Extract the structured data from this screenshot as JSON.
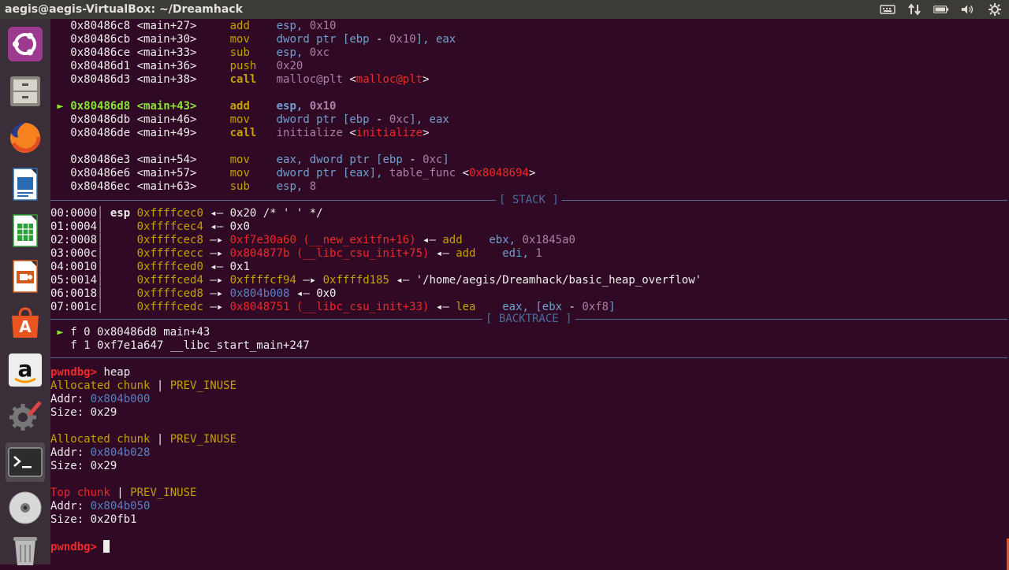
{
  "window": {
    "title": "aegis@aegis-VirtualBox: ~/Dreamhack"
  },
  "tray_icons": [
    "keyboard-icon",
    "network-icon",
    "battery-icon",
    "volume-icon",
    "settings-gear-icon"
  ],
  "launcher": [
    {
      "name": "ubuntu-dash-icon"
    },
    {
      "name": "files-icon"
    },
    {
      "name": "firefox-icon"
    },
    {
      "name": "libreoffice-writer-icon"
    },
    {
      "name": "libreoffice-calc-icon"
    },
    {
      "name": "libreoffice-impress-icon"
    },
    {
      "name": "software-center-icon"
    },
    {
      "name": "amazon-icon"
    },
    {
      "name": "system-settings-icon"
    },
    {
      "name": "terminal-icon"
    },
    {
      "name": "dvd-icon"
    },
    {
      "name": "trash-icon"
    }
  ],
  "colors": {
    "terminal_bg": "#300a24",
    "launcher_bg": "#3a2f38",
    "topbar_bg": "#3c3b37"
  },
  "disasm": [
    {
      "marker": "",
      "addr": "0x80486c8",
      "off": "<main+27>",
      "mn": "add",
      "ops": [
        [
          "esp, ",
          "blue"
        ],
        [
          "0x10",
          "purple"
        ]
      ],
      "cur": false
    },
    {
      "marker": "",
      "addr": "0x80486cb",
      "off": "<main+30>",
      "mn": "mov",
      "ops": [
        [
          "dword ptr [",
          "blue"
        ],
        [
          "ebp",
          "blue"
        ],
        [
          " - ",
          "white"
        ],
        [
          "0x10",
          "purple"
        ],
        [
          "], ",
          "blue"
        ],
        [
          "eax",
          "blue"
        ]
      ],
      "cur": false
    },
    {
      "marker": "",
      "addr": "0x80486ce",
      "off": "<main+33>",
      "mn": "sub",
      "ops": [
        [
          "esp, ",
          "blue"
        ],
        [
          "0xc",
          "purple"
        ]
      ],
      "cur": false
    },
    {
      "marker": "",
      "addr": "0x80486d1",
      "off": "<main+36>",
      "mn": "push",
      "ops": [
        [
          "0x20",
          "purple"
        ]
      ],
      "cur": false
    },
    {
      "marker": "",
      "addr": "0x80486d3",
      "off": "<main+38>",
      "mn": "call",
      "ops": [
        [
          "malloc@plt ",
          "purple"
        ],
        [
          "<",
          "white"
        ],
        [
          "malloc@plt",
          "red"
        ],
        [
          ">",
          "white"
        ]
      ],
      "cur": false,
      "bold": true
    },
    {
      "blank": true
    },
    {
      "marker": "►",
      "addr": "0x80486d8",
      "off": "<main+43>",
      "mn": "add",
      "ops": [
        [
          "esp, ",
          "blue"
        ],
        [
          "0x10",
          "purple"
        ]
      ],
      "cur": true
    },
    {
      "marker": "",
      "addr": "0x80486db",
      "off": "<main+46>",
      "mn": "mov",
      "ops": [
        [
          "dword ptr [",
          "blue"
        ],
        [
          "ebp",
          "blue"
        ],
        [
          " - ",
          "white"
        ],
        [
          "0xc",
          "purple"
        ],
        [
          "], ",
          "blue"
        ],
        [
          "eax",
          "blue"
        ]
      ],
      "cur": false
    },
    {
      "marker": "",
      "addr": "0x80486de",
      "off": "<main+49>",
      "mn": "call",
      "ops": [
        [
          "initialize ",
          "purple"
        ],
        [
          "<",
          "white"
        ],
        [
          "initialize",
          "red"
        ],
        [
          ">",
          "white"
        ]
      ],
      "cur": false,
      "bold": true
    },
    {
      "blank": true
    },
    {
      "marker": "",
      "addr": "0x80486e3",
      "off": "<main+54>",
      "mn": "mov",
      "ops": [
        [
          "eax, dword ptr [",
          "blue"
        ],
        [
          "ebp",
          "blue"
        ],
        [
          " - ",
          "white"
        ],
        [
          "0xc",
          "purple"
        ],
        [
          "]",
          "blue"
        ]
      ],
      "cur": false
    },
    {
      "marker": "",
      "addr": "0x80486e6",
      "off": "<main+57>",
      "mn": "mov",
      "ops": [
        [
          "dword ptr [",
          "blue"
        ],
        [
          "eax",
          "blue"
        ],
        [
          "], ",
          "blue"
        ],
        [
          "table_func ",
          "purple"
        ],
        [
          "<",
          "white"
        ],
        [
          "0x8048694",
          "red"
        ],
        [
          ">",
          "white"
        ]
      ],
      "cur": false
    },
    {
      "marker": "",
      "addr": "0x80486ec",
      "off": "<main+63>",
      "mn": "sub",
      "ops": [
        [
          "esp, ",
          "blue"
        ],
        [
          "8",
          "purple"
        ]
      ],
      "cur": false
    }
  ],
  "stack_label": "[ STACK ]",
  "stack": [
    [
      [
        "00:0000",
        "white"
      ],
      [
        "│ ",
        "dim"
      ],
      [
        "esp ",
        "white",
        "bold"
      ],
      [
        "0xffffcec0",
        "yellow"
      ],
      [
        " ◂— ",
        "white"
      ],
      [
        "0x20 /* ' ' */",
        "white"
      ]
    ],
    [
      [
        "01:0004",
        "white"
      ],
      [
        "│     ",
        "dim"
      ],
      [
        "0xffffcec4",
        "yellow"
      ],
      [
        " ◂— ",
        "white"
      ],
      [
        "0x0",
        "white"
      ]
    ],
    [
      [
        "02:0008",
        "white"
      ],
      [
        "│     ",
        "dim"
      ],
      [
        "0xffffcec8",
        "yellow"
      ],
      [
        " —▸ ",
        "white"
      ],
      [
        "0xf7e30a60 (__new_exitfn+16)",
        "red"
      ],
      [
        " ◂— ",
        "white"
      ],
      [
        "add",
        "yellow"
      ],
      [
        "    ",
        "white"
      ],
      [
        "ebx, ",
        "blue"
      ],
      [
        "0x1845a0",
        "purple"
      ]
    ],
    [
      [
        "03:000c",
        "white"
      ],
      [
        "│     ",
        "dim"
      ],
      [
        "0xffffcecc",
        "yellow"
      ],
      [
        " —▸ ",
        "white"
      ],
      [
        "0x804877b (__libc_csu_init+75)",
        "red"
      ],
      [
        " ◂— ",
        "white"
      ],
      [
        "add",
        "yellow"
      ],
      [
        "    ",
        "white"
      ],
      [
        "edi, ",
        "blue"
      ],
      [
        "1",
        "purple"
      ]
    ],
    [
      [
        "04:0010",
        "white"
      ],
      [
        "│     ",
        "dim"
      ],
      [
        "0xffffced0",
        "yellow"
      ],
      [
        " ◂— ",
        "white"
      ],
      [
        "0x1",
        "white"
      ]
    ],
    [
      [
        "05:0014",
        "white"
      ],
      [
        "│     ",
        "dim"
      ],
      [
        "0xffffced4",
        "yellow"
      ],
      [
        " —▸ ",
        "white"
      ],
      [
        "0xffffcf94",
        "yellow"
      ],
      [
        " —▸ ",
        "white"
      ],
      [
        "0xffffd185",
        "yellow"
      ],
      [
        " ◂— ",
        "white"
      ],
      [
        "'/home/aegis/Dreamhack/basic_heap_overflow'",
        "white"
      ]
    ],
    [
      [
        "06:0018",
        "white"
      ],
      [
        "│     ",
        "dim"
      ],
      [
        "0xffffced8",
        "yellow"
      ],
      [
        " —▸ ",
        "white"
      ],
      [
        "0x804b008",
        "addr"
      ],
      [
        " ◂— ",
        "white"
      ],
      [
        "0x0",
        "white"
      ]
    ],
    [
      [
        "07:001c",
        "white"
      ],
      [
        "│     ",
        "dim"
      ],
      [
        "0xffffcedc",
        "yellow"
      ],
      [
        " —▸ ",
        "white"
      ],
      [
        "0x8048751 (__libc_csu_init+33)",
        "red"
      ],
      [
        " ◂— ",
        "white"
      ],
      [
        "lea",
        "yellow"
      ],
      [
        "    ",
        "white"
      ],
      [
        "eax, [",
        "blue"
      ],
      [
        "ebx",
        "blue"
      ],
      [
        " - ",
        "white"
      ],
      [
        "0xf8",
        "purple"
      ],
      [
        "]",
        "blue"
      ]
    ]
  ],
  "backtrace_label": "[ BACKTRACE ]",
  "backtrace": [
    [
      [
        " ► ",
        "white"
      ],
      [
        "f 0 0x80486d8 main+43",
        "white"
      ]
    ],
    [
      [
        "   ",
        "white"
      ],
      [
        "f 1 0xf7e1a647 __libc_start_main+247",
        "white"
      ]
    ]
  ],
  "heap": [
    {
      "blank": true
    },
    [
      [
        "pwndbg> ",
        "red",
        "bold"
      ],
      [
        "heap",
        "white"
      ]
    ],
    [
      [
        "Allocated chunk",
        "yellow"
      ],
      [
        " | ",
        "white"
      ],
      [
        "PREV_INUSE",
        "yellow"
      ]
    ],
    [
      [
        "Addr: ",
        "white"
      ],
      [
        "0x804b000",
        "addr"
      ]
    ],
    [
      [
        "Size: ",
        "white"
      ],
      [
        "0x29",
        "white"
      ]
    ],
    {
      "blank": true
    },
    [
      [
        "Allocated chunk",
        "yellow"
      ],
      [
        " | ",
        "white"
      ],
      [
        "PREV_INUSE",
        "yellow"
      ]
    ],
    [
      [
        "Addr: ",
        "white"
      ],
      [
        "0x804b028",
        "addr"
      ]
    ],
    [
      [
        "Size: ",
        "white"
      ],
      [
        "0x29",
        "white"
      ]
    ],
    {
      "blank": true
    },
    [
      [
        "Top chunk",
        "red"
      ],
      [
        " | ",
        "white"
      ],
      [
        "PREV_INUSE",
        "yellow"
      ]
    ],
    [
      [
        "Addr: ",
        "white"
      ],
      [
        "0x804b050",
        "addr"
      ]
    ],
    [
      [
        "Size: ",
        "white"
      ],
      [
        "0x20fb1",
        "white"
      ]
    ],
    {
      "blank": true
    },
    [
      [
        "pwndbg> ",
        "red",
        "bold"
      ]
    ]
  ]
}
